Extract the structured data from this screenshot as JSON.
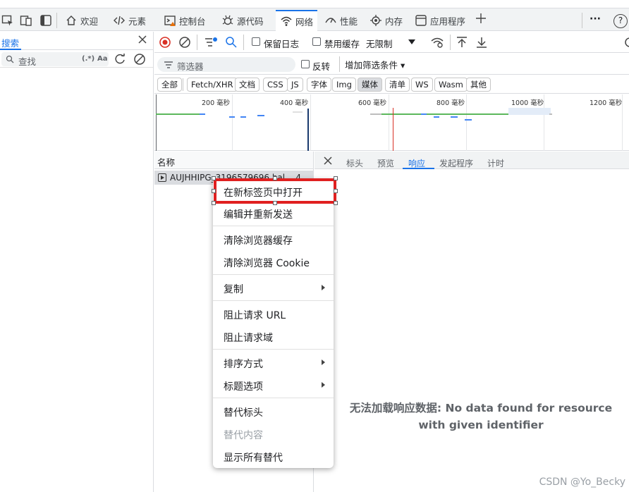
{
  "tabbar": {
    "tabs": [
      {
        "label": "欢迎",
        "icon": "home-icon"
      },
      {
        "label": "元素",
        "icon": "code-icon"
      },
      {
        "label": "控制台",
        "icon": "console-icon"
      },
      {
        "label": "源代码",
        "icon": "bug-icon"
      },
      {
        "label": "网络",
        "icon": "wifi-icon"
      },
      {
        "label": "性能",
        "icon": "gauge-icon"
      },
      {
        "label": "内存",
        "icon": "memory-icon"
      },
      {
        "label": "应用程序",
        "icon": "app-icon"
      }
    ],
    "active_tab": "网络",
    "more_glyph": "···",
    "help_glyph": "?"
  },
  "search_panel": {
    "tab_label": "搜索",
    "placeholder": "查找",
    "regex_label": "(.*)",
    "case_label": "Aa"
  },
  "toolbar": {
    "preserve_log": "保留日志",
    "disable_cache": "禁用缓存",
    "throttle": "无限制"
  },
  "filter_bar": {
    "placeholder": "筛选器",
    "invert": "反转",
    "more_filters": "增加筛选条件 ▾"
  },
  "type_filters": [
    "全部",
    "Fetch/XHR",
    "文档",
    "CSS",
    "JS",
    "字体",
    "Img",
    "媒体",
    "清单",
    "WS",
    "Wasm",
    "其他"
  ],
  "selected_type_filter": "媒体",
  "overview": {
    "ticks": [
      "200 毫秒",
      "400 毫秒",
      "600 毫秒",
      "800 毫秒",
      "1000 毫秒",
      "1200 毫秒"
    ],
    "colors": {
      "green": "#5cb85c",
      "blue": "#4285f4",
      "red": "#d93025",
      "gray": "#bdbdbd"
    }
  },
  "request_list": {
    "header": "名称",
    "rows": [
      {
        "name": "AUJHHIPG_3196579696.bal  ...4"
      }
    ]
  },
  "details": {
    "tabs": [
      "标头",
      "预览",
      "响应",
      "发起程序",
      "计时"
    ],
    "active_tab": "响应",
    "message": "无法加载响应数据: No data found for resource with given identifier"
  },
  "context_menu": {
    "items": [
      {
        "label": "在新标签页中打开",
        "submenu": false,
        "disabled": false
      },
      {
        "label": "编辑并重新发送",
        "submenu": false,
        "disabled": false
      },
      {
        "label": "清除浏览器缓存",
        "submenu": false,
        "disabled": false
      },
      {
        "label": "清除浏览器 Cookie",
        "submenu": false,
        "disabled": false
      },
      {
        "label": "复制",
        "submenu": true,
        "disabled": false
      },
      {
        "label": "阻止请求 URL",
        "submenu": false,
        "disabled": false
      },
      {
        "label": "阻止请求域",
        "submenu": false,
        "disabled": false
      },
      {
        "label": "排序方式",
        "submenu": true,
        "disabled": false
      },
      {
        "label": "标题选项",
        "submenu": true,
        "disabled": false
      },
      {
        "label": "替代标头",
        "submenu": false,
        "disabled": false
      },
      {
        "label": "替代内容",
        "submenu": false,
        "disabled": true
      },
      {
        "label": "显示所有替代",
        "submenu": false,
        "disabled": false
      }
    ]
  },
  "watermark": "CSDN @Yo_Becky"
}
